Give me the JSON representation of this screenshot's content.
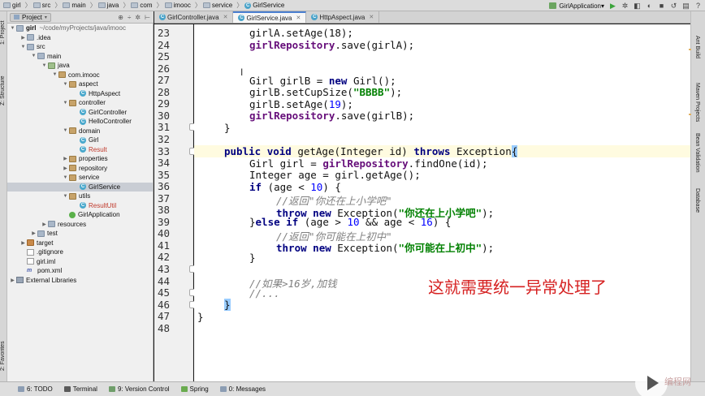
{
  "navbar": {
    "breadcrumbs": [
      "girl",
      "src",
      "main",
      "java",
      "com",
      "imooc",
      "service",
      "GirlService"
    ],
    "run_config": "GirlApplication"
  },
  "project_panel": {
    "dropdown_label": "Project",
    "tree": [
      {
        "label": "girl",
        "suffix": "~/code/myProjects/java/imooc",
        "type": "folder",
        "depth": 0,
        "expanded": true
      },
      {
        "label": ".idea",
        "type": "folder",
        "depth": 1,
        "expanded": false
      },
      {
        "label": "src",
        "type": "folder",
        "depth": 1,
        "expanded": true
      },
      {
        "label": "main",
        "type": "folder",
        "depth": 2,
        "expanded": true
      },
      {
        "label": "java",
        "type": "src",
        "depth": 3,
        "expanded": true
      },
      {
        "label": "com.imooc",
        "type": "pkg",
        "depth": 4,
        "expanded": true
      },
      {
        "label": "aspect",
        "type": "pkg",
        "depth": 5,
        "expanded": true
      },
      {
        "label": "HttpAspect",
        "type": "class",
        "depth": 6
      },
      {
        "label": "controller",
        "type": "pkg",
        "depth": 5,
        "expanded": true
      },
      {
        "label": "GirlController",
        "type": "class",
        "depth": 6
      },
      {
        "label": "HelloController",
        "type": "class",
        "depth": 6
      },
      {
        "label": "domain",
        "type": "pkg",
        "depth": 5,
        "expanded": true
      },
      {
        "label": "Girl",
        "type": "class",
        "depth": 6
      },
      {
        "label": "Result",
        "type": "class",
        "depth": 6,
        "color": "#c0392b"
      },
      {
        "label": "properties",
        "type": "pkg",
        "depth": 5,
        "expanded": false
      },
      {
        "label": "repository",
        "type": "pkg",
        "depth": 5,
        "expanded": false
      },
      {
        "label": "service",
        "type": "pkg",
        "depth": 5,
        "expanded": true
      },
      {
        "label": "GirlService",
        "type": "class",
        "depth": 6,
        "selected": true
      },
      {
        "label": "utils",
        "type": "pkg",
        "depth": 5,
        "expanded": true
      },
      {
        "label": "ResultUtil",
        "type": "class",
        "depth": 6,
        "color": "#c0392b"
      },
      {
        "label": "GirlApplication",
        "type": "app",
        "depth": 5
      },
      {
        "label": "resources",
        "type": "folder",
        "depth": 3,
        "expanded": false
      },
      {
        "label": "test",
        "type": "folder",
        "depth": 2,
        "expanded": false
      },
      {
        "label": "target",
        "type": "target",
        "depth": 1,
        "expanded": false
      },
      {
        "label": ".gitignore",
        "type": "file",
        "depth": 1
      },
      {
        "label": "girl.iml",
        "type": "file",
        "depth": 1
      },
      {
        "label": "pom.xml",
        "type": "xml",
        "depth": 1
      },
      {
        "label": "External Libraries",
        "type": "lib",
        "depth": 0,
        "expanded": false
      }
    ]
  },
  "tabs": [
    {
      "label": "GirlController.java",
      "active": false
    },
    {
      "label": "GirlService.java",
      "active": true
    },
    {
      "label": "HttpAspect.java",
      "active": false
    }
  ],
  "left_tool_tabs": {
    "project": "1: Project",
    "structure": "Z: Structure",
    "favorites": "2: Favorites"
  },
  "right_tool_tabs": [
    "Ant Build",
    "Maven Projects",
    "Bean Validation",
    "Database"
  ],
  "editor": {
    "line_numbers": [
      "23",
      "24",
      "25",
      "26",
      "27",
      "28",
      "29",
      "30",
      "31",
      "32",
      "33",
      "34",
      "35",
      "36",
      "37",
      "38",
      "39",
      "40",
      "41",
      "42",
      "43",
      "44",
      "45",
      "46",
      "47",
      "48"
    ],
    "current_line": "33",
    "code": {
      "l23": "girlA.setAge(18);",
      "l24_fld": "girlRepository",
      "l24_rest": ".save(girlA);",
      "l27_type": "Girl girlB = ",
      "l27_kw": "new",
      "l27_rest": " Girl();",
      "l28_a": "girlB.setCupSize(",
      "l28_str": "\"BBBB\"",
      "l28_b": ");",
      "l29_a": "girlB.setAge(",
      "l29_num": "19",
      "l29_b": ");",
      "l30_fld": "girlRepository",
      "l30_rest": ".save(girlB);",
      "l31": "}",
      "l33_kw1": "public",
      "l33_kw2": "void",
      "l33_mid": " getAge(Integer id) ",
      "l33_kw3": "throws",
      "l33_end": " Exception",
      "l33_brace": "{",
      "l34_a": "Girl girl = ",
      "l34_fld": "girlRepository",
      "l34_b": ".findOne(id);",
      "l35": "Integer age = girl.getAge();",
      "l36_kw": "if",
      "l36_a": " (age < ",
      "l36_num": "10",
      "l36_b": ") {",
      "l37_cm": "//返回\"你还在上小学吧\"",
      "l38_kw1": "throw",
      "l38_kw2": "new",
      "l38_a": " Exception(",
      "l38_str": "\"你还在上小学吧\"",
      "l38_b": ");",
      "l39_a": "}",
      "l39_kw1": "else",
      "l39_kw2": "if",
      "l39_b": " (age > ",
      "l39_num1": "10",
      "l39_c": " && age < ",
      "l39_num2": "16",
      "l39_d": ") {",
      "l40_cm": "//返回\"你可能在上初中\"",
      "l41_kw1": "throw",
      "l41_kw2": "new",
      "l41_a": " Exception(",
      "l41_str": "\"你可能在上初中\"",
      "l41_b": ");",
      "l42": "}",
      "l44_cm": "//如果>16岁,加钱",
      "l45_cm": "//...",
      "l46_brace": "}",
      "l47": "}"
    },
    "annotation": "这就需要统一异常处理了"
  },
  "status_bar": [
    {
      "label": "6: TODO",
      "color": "#8c9db3"
    },
    {
      "label": "Terminal",
      "color": "#5a5a5a"
    },
    {
      "label": "9: Version Control",
      "color": "#6f9e6a"
    },
    {
      "label": "Spring",
      "color": "#6aab4f"
    },
    {
      "label": "0: Messages",
      "color": "#8c9db3"
    }
  ],
  "watermark": "编程网"
}
